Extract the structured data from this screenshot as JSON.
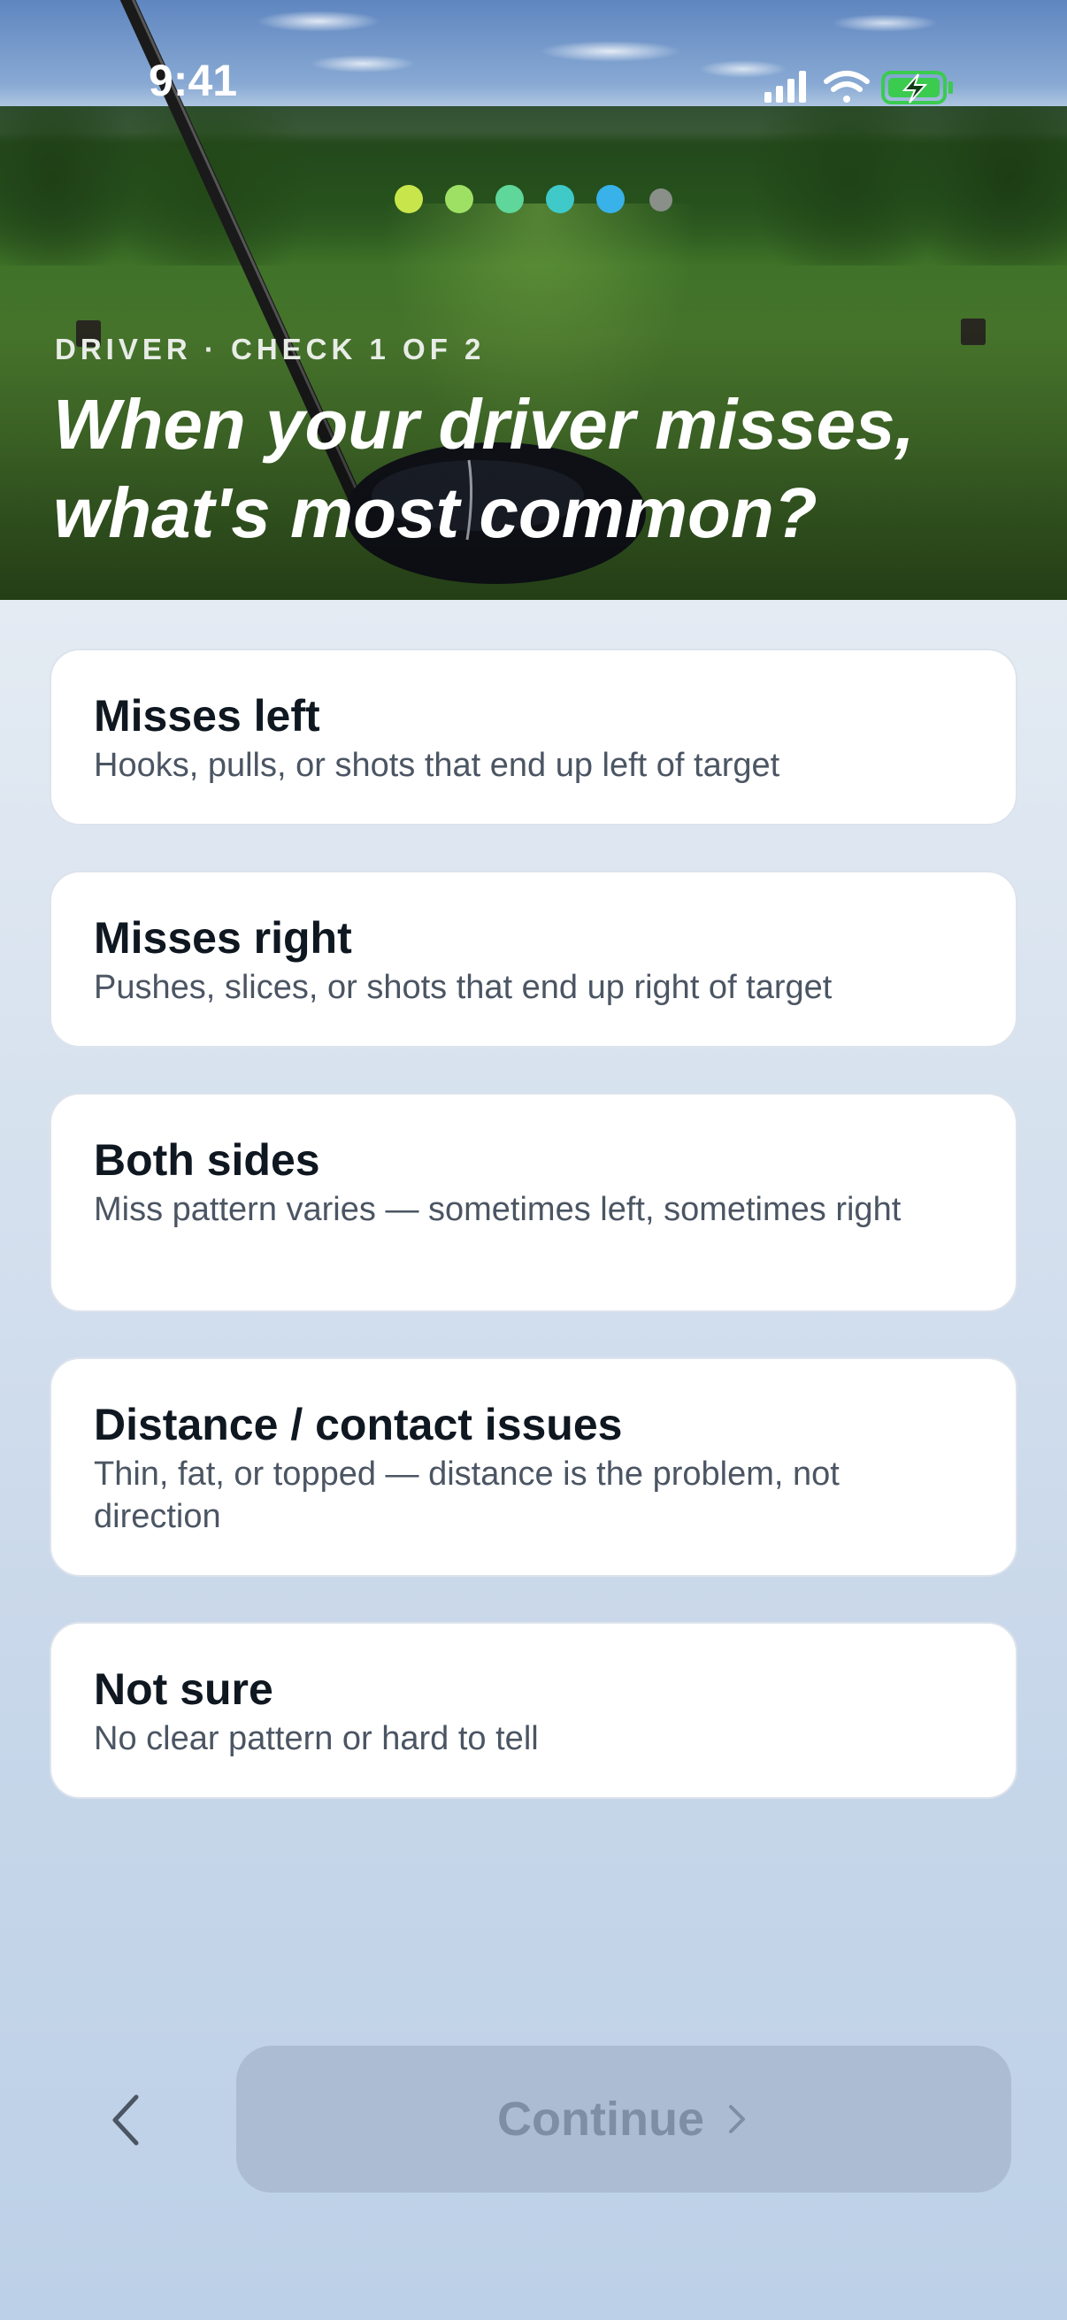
{
  "status_bar": {
    "time": "9:41",
    "icons": [
      "signal-icon",
      "wifi-icon",
      "battery-charging-icon"
    ]
  },
  "progress": {
    "total_steps": 6,
    "current_step": 5,
    "dot_colors": [
      "#c8e64b",
      "#9ee064",
      "#5fd69a",
      "#3fc9c8",
      "#38b2e8",
      "#8a8f8a"
    ]
  },
  "hero": {
    "eyebrow": "DRIVER · CHECK 1 OF 2",
    "headline": "When your driver misses, what's most common?"
  },
  "options": [
    {
      "title": "Misses left",
      "description": "Hooks, pulls, or shots that end up left of target"
    },
    {
      "title": "Misses right",
      "description": "Pushes, slices, or shots that end up right of target"
    },
    {
      "title": "Both sides",
      "description": "Miss pattern varies — sometimes left, sometimes right"
    },
    {
      "title": "Distance / contact issues",
      "description": "Thin, fat, or topped — distance is the problem, not direction"
    },
    {
      "title": "Not sure",
      "description": "No clear pattern or hard to tell"
    }
  ],
  "footer": {
    "back_icon": "chevron-left-icon",
    "continue_label": "Continue",
    "continue_icon": "chevron-right-icon",
    "continue_enabled": false
  }
}
